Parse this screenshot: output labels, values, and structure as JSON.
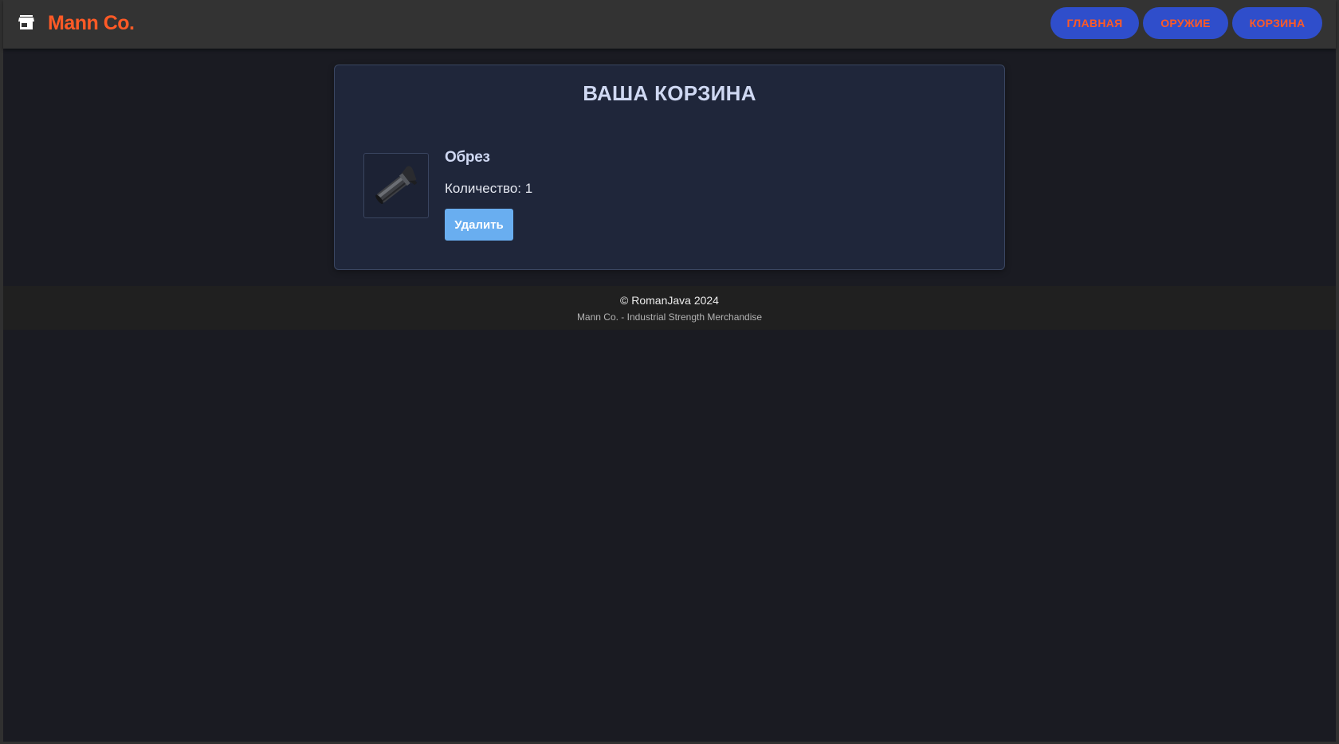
{
  "header": {
    "brand": "Mann Co.",
    "brand_icon": "store-icon",
    "brand_color": "#ff5a26",
    "nav": [
      {
        "label": "ГЛАВНАЯ"
      },
      {
        "label": "ОРУЖИЕ"
      },
      {
        "label": "КОРЗИНА"
      }
    ],
    "nav_bg_color": "#2f4ecb"
  },
  "cart": {
    "title": "ВАША КОРЗИНА",
    "items": [
      {
        "name": "Обрез",
        "image_icon": "shotgun-image",
        "quantity_text": "Количество: 1",
        "delete_label": "Удалить"
      }
    ],
    "delete_button_color": "#69aef0"
  },
  "footer": {
    "copyright": "© RomanJava 2024",
    "tagline": "Mann Co. - Industrial Strength Merchandise"
  }
}
